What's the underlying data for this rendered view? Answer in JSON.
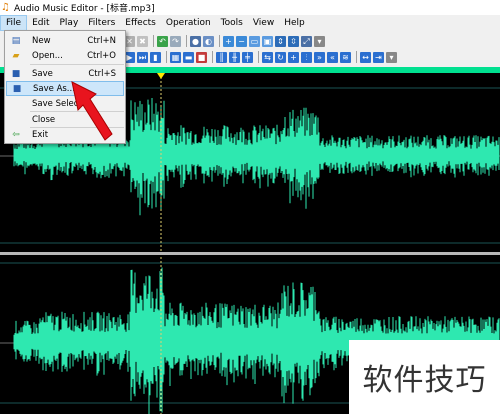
{
  "window": {
    "title": "Audio Music Editor - [标音.mp3]",
    "icon": "music-note-icon"
  },
  "menubar": {
    "items": [
      "File",
      "Edit",
      "Play",
      "Filters",
      "Effects",
      "Operation",
      "Tools",
      "View",
      "Help"
    ],
    "active": "File"
  },
  "file_menu": {
    "items": [
      {
        "label": "New",
        "shortcut": "Ctrl+N",
        "icon": "new-file-icon"
      },
      {
        "label": "Open...",
        "shortcut": "Ctrl+O",
        "icon": "open-folder-icon"
      },
      {
        "label": "Save",
        "shortcut": "Ctrl+S",
        "icon": "save-icon"
      },
      {
        "label": "Save As...",
        "shortcut": "",
        "icon": "save-as-icon"
      },
      {
        "label": "Save Selecti",
        "shortcut": "",
        "icon": ""
      },
      {
        "label": "Close",
        "shortcut": "",
        "icon": ""
      },
      {
        "label": "Exit",
        "shortcut": "",
        "icon": "exit-icon"
      }
    ],
    "highlighted": "Save As..."
  },
  "colors": {
    "waveform": "#2ee8b0",
    "background": "#000000",
    "timeline": "#00e090",
    "arrow": "#e8141e"
  },
  "watermark": {
    "text": "软件技巧"
  }
}
